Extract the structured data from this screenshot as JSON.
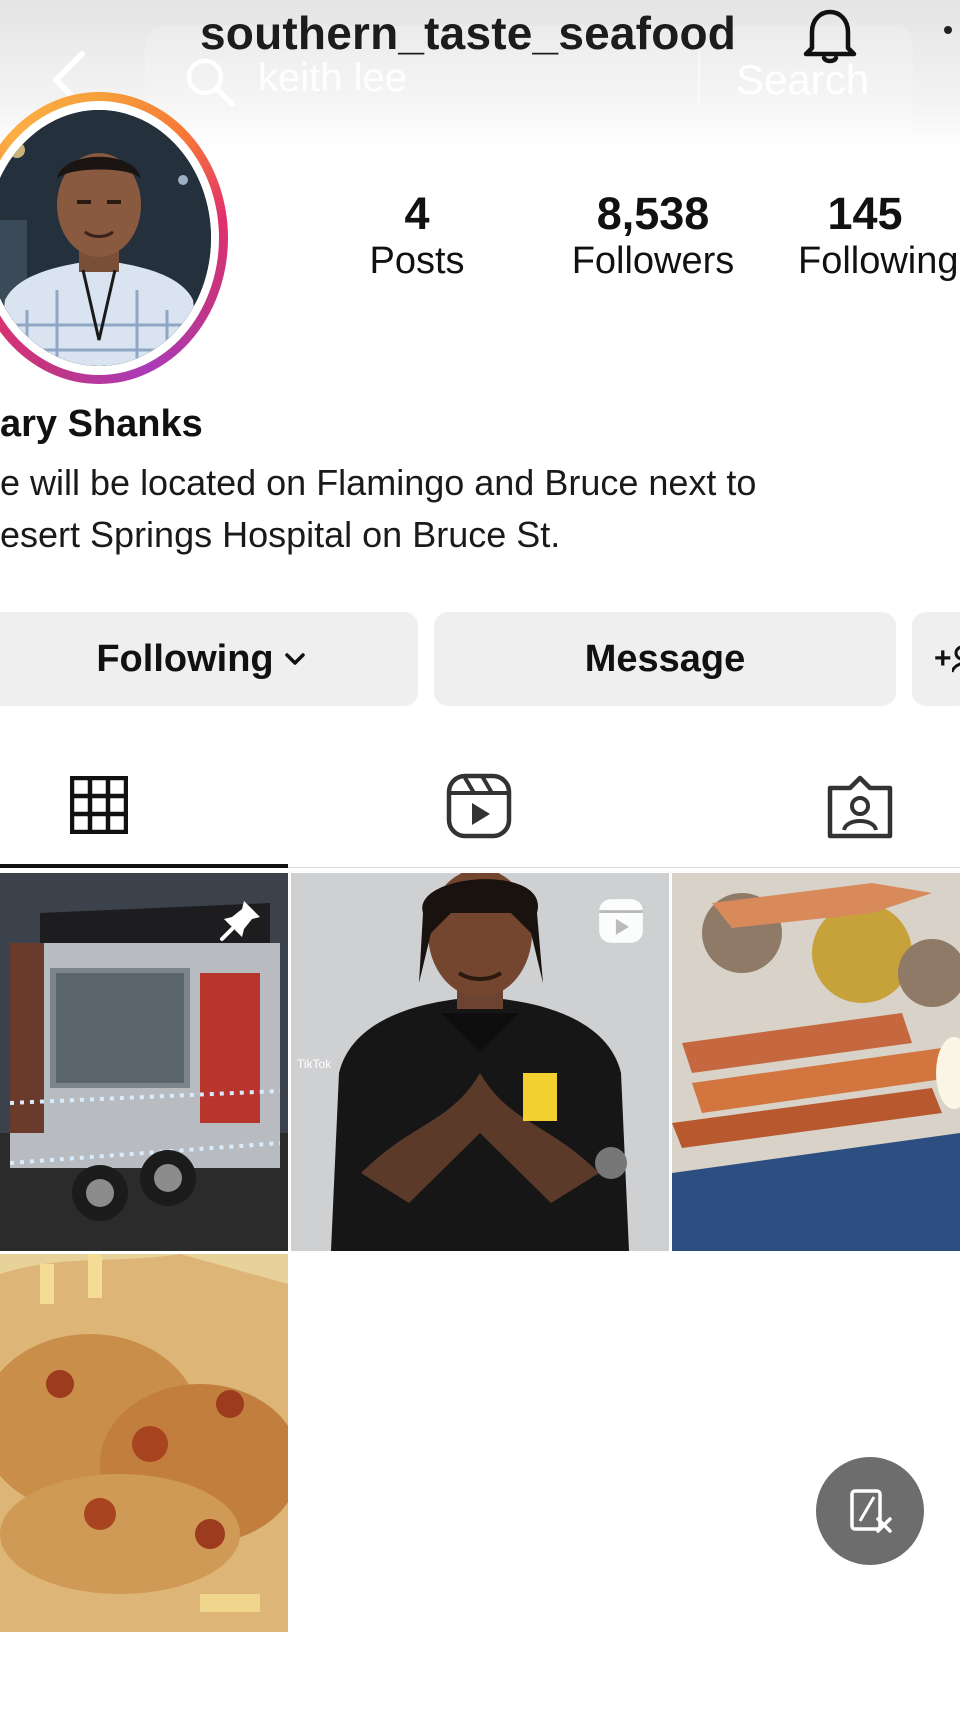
{
  "header": {
    "username": "southern_taste_seafood",
    "search_query": "keith lee",
    "search_button": "Search",
    "icons": [
      "back-chevron-icon",
      "search-icon",
      "bell-icon",
      "more-icon"
    ]
  },
  "profile": {
    "name": "ary Shanks",
    "bio_lines": [
      "e will be located on Flamingo and Bruce next to",
      "esert Springs Hospital on Bruce St."
    ],
    "ring_colors": [
      "#fcaf45",
      "#e1306c",
      "#c13584"
    ]
  },
  "stats": [
    {
      "value": "4",
      "label": "Posts"
    },
    {
      "value": "8,538",
      "label": "Followers"
    },
    {
      "value": "145",
      "label": "Following"
    }
  ],
  "actions": {
    "following": "Following",
    "message": "Message",
    "add_user_label": "+"
  },
  "tabs": [
    {
      "icon": "grid-icon",
      "selected": true
    },
    {
      "icon": "reels-icon",
      "selected": false
    },
    {
      "icon": "tagged-icon",
      "selected": false
    }
  ],
  "posts": [
    {
      "kind": "food-trailer",
      "badge": "pin-icon"
    },
    {
      "kind": "tiktok-video",
      "badge": "reels-icon",
      "watermark": "TikTok"
    },
    {
      "kind": "crab-boil",
      "badge": null
    },
    {
      "kind": "loaded-fries",
      "badge": null
    }
  ],
  "fab_icon": "screenshot-close-icon"
}
